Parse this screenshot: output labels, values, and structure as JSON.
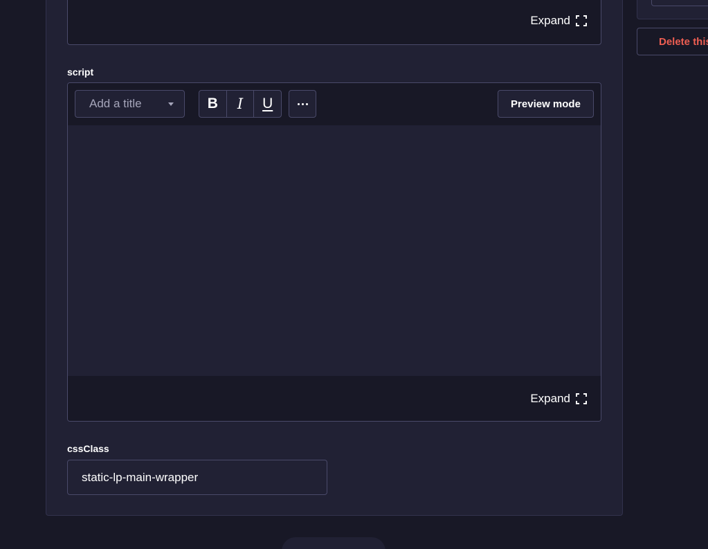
{
  "top_editor": {
    "expand_label": "Expand"
  },
  "script_field": {
    "label": "script",
    "title_select": {
      "placeholder": "Add a title"
    },
    "format": {
      "bold": "B",
      "italic": "I",
      "underline": "U"
    },
    "preview_label": "Preview mode",
    "expand_label": "Expand"
  },
  "css_class_field": {
    "label": "cssClass",
    "value": "static-lp-main-wrapper"
  },
  "sidebar": {
    "delete_label": "Delete this entry"
  },
  "colors": {
    "background": "#181826",
    "card": "#212134",
    "border": "#4a4a6a",
    "danger": "#ee5e52"
  }
}
